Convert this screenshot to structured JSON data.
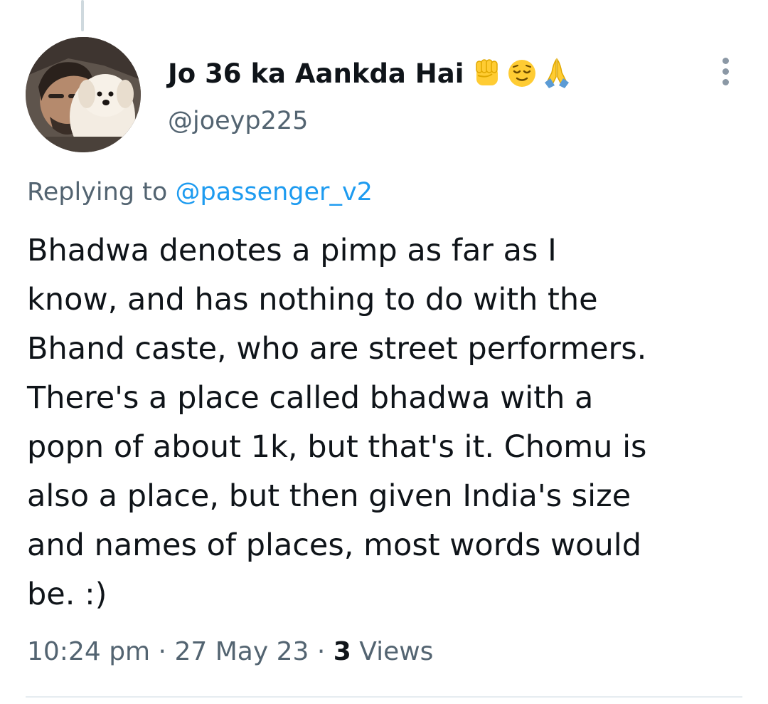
{
  "author": {
    "display_name": "Jo 36 ka Aankda Hai",
    "name_emojis": [
      "raised-fist-icon",
      "relieved-face-icon",
      "folded-hands-icon"
    ],
    "handle": "@joeyp225"
  },
  "reply": {
    "prefix": "Replying to ",
    "mention": "@passenger_v2"
  },
  "tweet": {
    "lines": [
      "Bhadwa denotes a pimp as far as I",
      "know, and has nothing to do with the",
      "Bhand caste, who are street performers.",
      "There's a place called bhadwa with a",
      "popn of about 1k, but that's it. Chomu is",
      "also a place, but then given India's size",
      "and names of places, most words would",
      "be. :)"
    ]
  },
  "meta": {
    "time": "10:24 pm",
    "sep1": " · ",
    "date": "27 May 23",
    "sep2": " · ",
    "views_count": "3",
    "views_label": " Views"
  },
  "colors": {
    "text": "#0f1419",
    "secondary": "#536471",
    "link": "#1d9bf0",
    "divider": "#e6ecf0"
  }
}
